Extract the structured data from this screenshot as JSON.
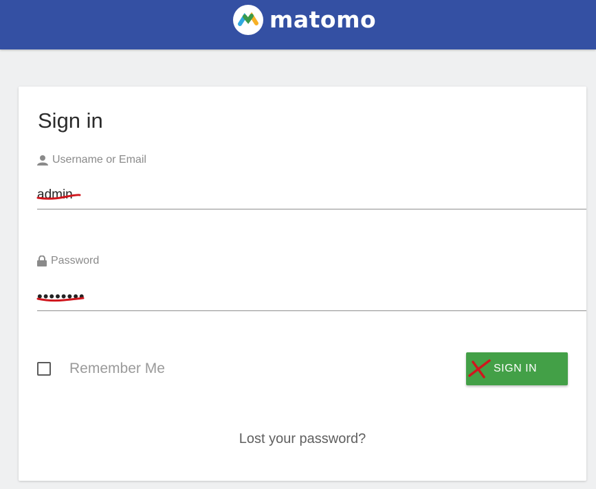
{
  "header": {
    "brand_name": "matomo",
    "background_color": "#3450a3",
    "logo_icon": "matomo-logo-icon"
  },
  "login_form": {
    "title": "Sign in",
    "username": {
      "label": "Username or Email",
      "value": "admin",
      "icon": "user-icon"
    },
    "password": {
      "label": "Password",
      "value": "••••••••",
      "icon": "lock-icon"
    },
    "remember_me": {
      "label": "Remember Me",
      "checked": false
    },
    "submit_label": "SIGN IN",
    "submit_color": "#43a047",
    "lost_password_link": "Lost your password?"
  }
}
